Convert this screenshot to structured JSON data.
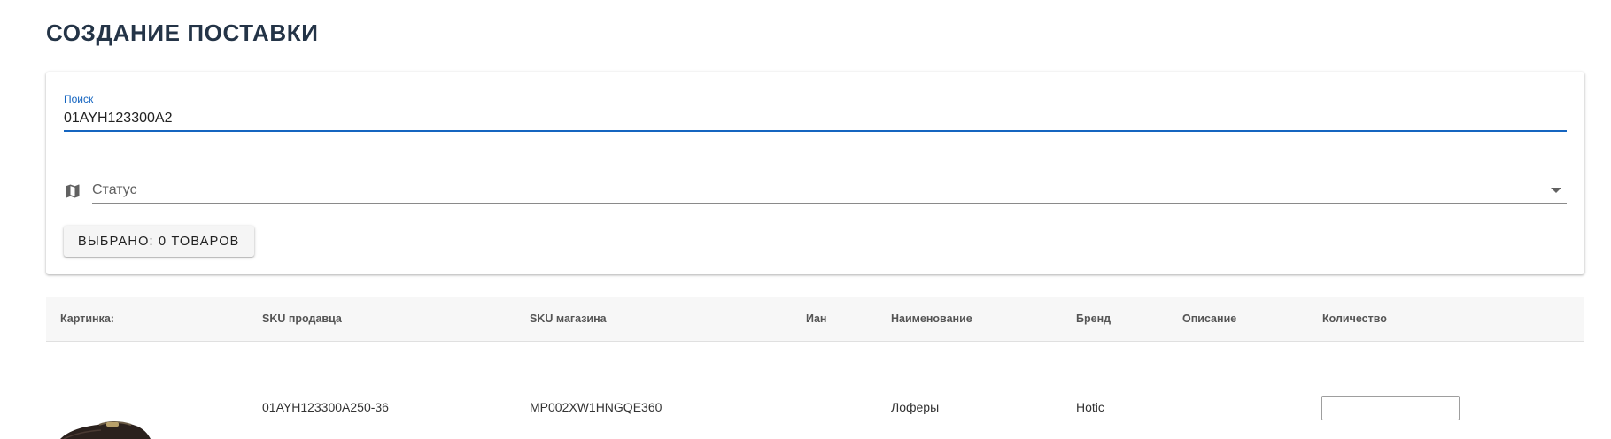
{
  "page": {
    "title": "СОЗДАНИЕ ПОСТАВКИ"
  },
  "filters": {
    "search_label": "Поиск",
    "search_value": "01AYH123300A2",
    "status_placeholder": "Статус",
    "selected_button_label": "ВЫБРАНО: 0 ТОВАРОВ"
  },
  "table": {
    "columns": [
      "Картинка:",
      "SKU продавца",
      "SKU магазина",
      "Иан",
      "Наименование",
      "Бренд",
      "Описание",
      "Количество"
    ],
    "rows": [
      {
        "image": "shoe-loafer-image",
        "sku_seller": "01AYH123300A250-36",
        "sku_store": "MP002XW1HNGQE360",
        "ian": "",
        "name": "Лоферы",
        "brand": "Hotic",
        "description": "",
        "quantity": ""
      }
    ]
  },
  "colors": {
    "accent": "#1565c0",
    "title": "#243447"
  },
  "icons": {
    "status_icon": "map-icon",
    "status_dropdown": "dropdown-arrow-icon"
  }
}
